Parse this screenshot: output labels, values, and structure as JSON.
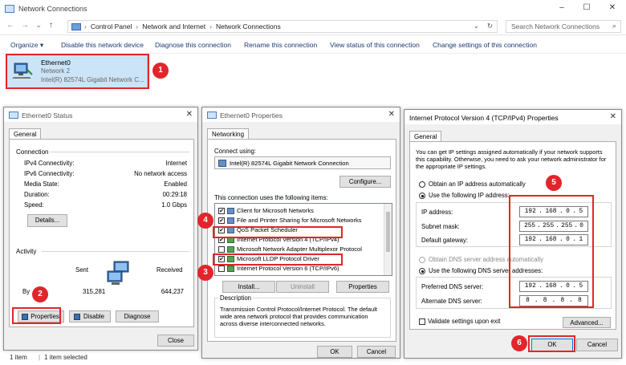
{
  "window": {
    "title": "Network Connections",
    "min": "–",
    "max": "☐",
    "close": "✕"
  },
  "nav": {
    "back": "←",
    "forward": "→",
    "history": "⌄",
    "up": "↑"
  },
  "address": {
    "crumbs": [
      "Control Panel",
      "Network and Internet",
      "Network Connections"
    ],
    "sep": "›",
    "dropdown": "⌄",
    "refresh": "↻",
    "search_placeholder": "Search Network Connections"
  },
  "commands": [
    "Organize ▾",
    "Disable this network device",
    "Diagnose this connection",
    "Rename this connection",
    "View status of this connection",
    "Change settings of this connection"
  ],
  "adapter": {
    "name": "Ethernet0",
    "network": "Network 2",
    "device": "Intel(R) 82574L Gigabit Network C..."
  },
  "badges": [
    "1",
    "2",
    "3",
    "4",
    "5",
    "6"
  ],
  "status_dialog": {
    "title": "Ethernet0 Status",
    "tab": "General",
    "connection_label": "Connection",
    "rows": [
      {
        "label": "IPv4 Connectivity:",
        "value": "Internet"
      },
      {
        "label": "IPv6 Connectivity:",
        "value": "No network access"
      },
      {
        "label": "Media State:",
        "value": "Enabled"
      },
      {
        "label": "Duration:",
        "value": "00:29:18"
      },
      {
        "label": "Speed:",
        "value": "1.0 Gbps"
      }
    ],
    "details_btn": "Details...",
    "activity_label": "Activity",
    "sent": "Sent",
    "received": "Received",
    "bytes_label": "By",
    "bytes_sent": "315,281",
    "bytes_received": "644,237",
    "properties_btn": "Properties",
    "disable_btn": "Disable",
    "diagnose_btn": "Diagnose",
    "close_btn": "Close"
  },
  "props_dialog": {
    "title": "Ethernet0 Properties",
    "tab": "Networking",
    "connect_using": "Connect using:",
    "adapter": "Intel(R) 82574L Gigabit Network Connection",
    "configure_btn": "Configure...",
    "items_label": "This connection uses the following items:",
    "items": [
      {
        "label": "Client for Microsoft Networks",
        "checked": "✔"
      },
      {
        "label": "File and Printer Sharing for Microsoft Networks",
        "checked": "✔"
      },
      {
        "label": "QoS Packet Scheduler",
        "checked": "✔"
      },
      {
        "label": "Internet Protocol Version 4 (TCP/IPv4)",
        "checked": "✔"
      },
      {
        "label": "Microsoft Network Adapter Multiplexor Protocol",
        "checked": ""
      },
      {
        "label": "Microsoft LLDP Protocol Driver",
        "checked": "✔"
      },
      {
        "label": "Internet Protocol Version 6 (TCP/IPv6)",
        "checked": ""
      }
    ],
    "install_btn": "Install...",
    "uninstall_btn": "Uninstall",
    "properties_btn": "Properties",
    "description_label": "Description",
    "description": "Transmission Control Protocol/Internet Protocol. The default wide area network protocol that provides communication across diverse interconnected networks.",
    "ok_btn": "OK",
    "cancel_btn": "Cancel"
  },
  "ipv4_dialog": {
    "title": "Internet Protocol Version 4 (TCP/IPv4) Properties",
    "tab": "General",
    "intro": "You can get IP settings assigned automatically if your network supports this capability. Otherwise, you need to ask your network administrator for the appropriate IP settings.",
    "obtain_ip": "Obtain an IP address automatically",
    "use_ip": "Use the following IP address:",
    "ip_label": "IP address:",
    "ip": [
      "192",
      "168",
      "0",
      "5"
    ],
    "mask_label": "Subnet mask:",
    "mask": [
      "255",
      "255",
      "255",
      "0"
    ],
    "gateway_label": "Default gateway:",
    "gateway": [
      "192",
      "168",
      "0",
      "1"
    ],
    "obtain_dns": "Obtain DNS server address automatically",
    "use_dns": "Use the following DNS server addresses:",
    "pref_label": "Preferred DNS server:",
    "pref": [
      "192",
      "168",
      "0",
      "5"
    ],
    "alt_label": "Alternate DNS server:",
    "alt": [
      "8",
      "8",
      "8",
      "8"
    ],
    "validate": "Validate settings upon exit",
    "advanced_btn": "Advanced...",
    "ok_btn": "OK",
    "cancel_btn": "Cancel"
  },
  "status": {
    "count": "1 item",
    "selected": "1 item selected"
  },
  "colors": {
    "accent": "#e0262b",
    "selection": "#cce4f7"
  }
}
